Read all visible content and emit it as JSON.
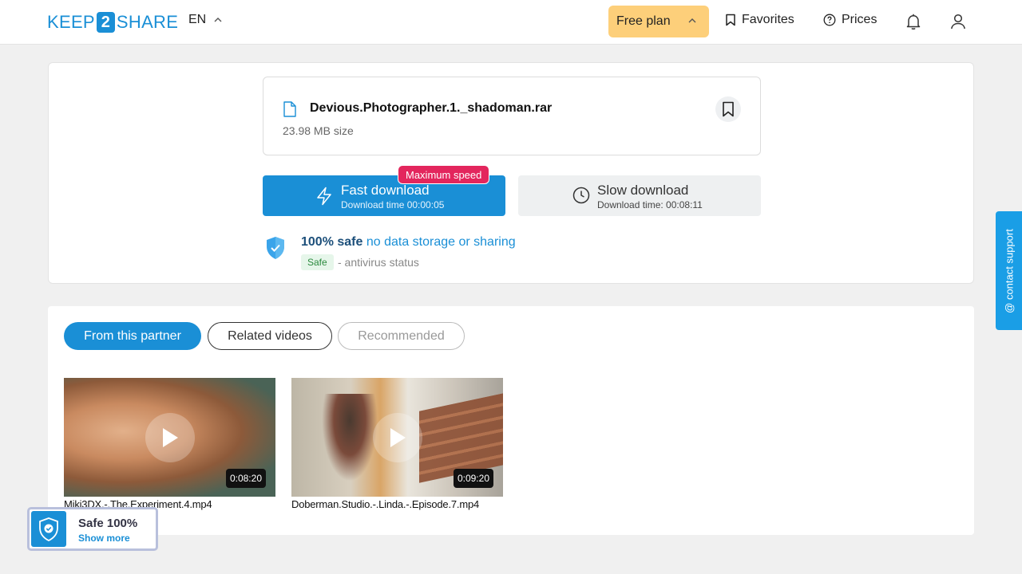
{
  "header": {
    "logo": {
      "left": "KEEP",
      "mid": "2",
      "right": "SHARE"
    },
    "language": "EN",
    "plan_label": "Free plan",
    "favorites_label": "Favorites",
    "prices_label": "Prices"
  },
  "file": {
    "name": "Devious.Photographer.1._shadoman.rar",
    "size": "23.98 MB",
    "size_suffix": "size"
  },
  "download": {
    "fast_title": "Fast download",
    "fast_time": "Download time 00:00:05",
    "speed_badge": "Maximum speed",
    "slow_title": "Slow download",
    "slow_time": "Download time: 00:08:11"
  },
  "safety": {
    "bold": "100% safe",
    "rest": "no data storage or sharing",
    "tag": "Safe",
    "status": "- antivirus status"
  },
  "tabs": [
    "From this partner",
    "Related videos",
    "Recommended"
  ],
  "videos": [
    {
      "title": "Miki3DX.-.The.Experiment.4.mp4",
      "duration": "0:08:20"
    },
    {
      "title": "Doberman.Studio.-.Linda.-.Episode.7.mp4",
      "duration": "0:09:20"
    }
  ],
  "support_label": "@ contact support",
  "safe_widget": {
    "title": "Safe 100%",
    "link": "Show more"
  },
  "colors": {
    "accent": "#1a8fd6",
    "plan": "#fdcf7a",
    "badge": "#e3265d"
  }
}
